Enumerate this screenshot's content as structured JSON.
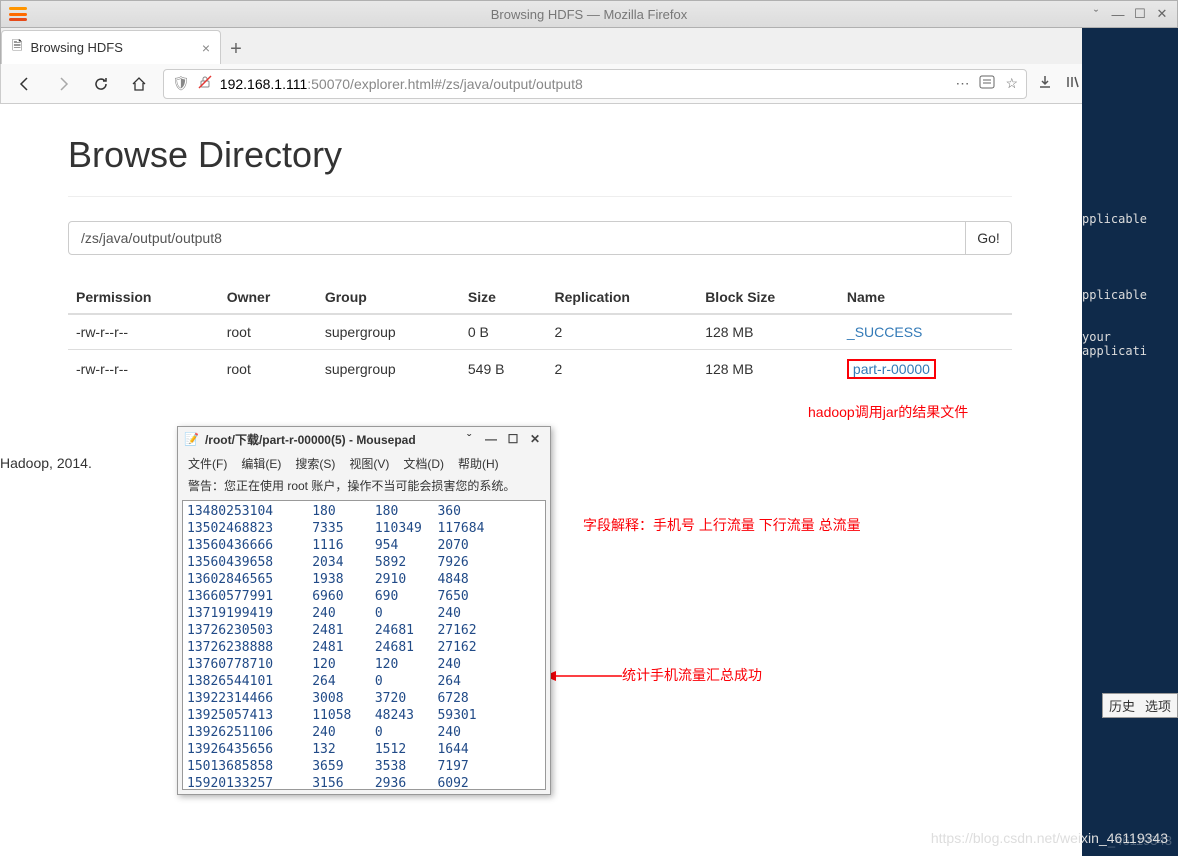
{
  "window": {
    "app_title": "Browsing HDFS — Mozilla Firefox",
    "tab_title": "Browsing HDFS"
  },
  "url": {
    "host": "192.168.1.111",
    "rest": ":50070/explorer.html#/zs/java/output/output8"
  },
  "page": {
    "heading": "Browse Directory",
    "path_value": "/zs/java/output/output8",
    "go_label": "Go!",
    "columns": [
      "Permission",
      "Owner",
      "Group",
      "Size",
      "Replication",
      "Block Size",
      "Name"
    ],
    "rows": [
      {
        "perm": "-rw-r--r--",
        "owner": "root",
        "group": "supergroup",
        "size": "0 B",
        "repl": "2",
        "bs": "128 MB",
        "name": "_SUCCESS"
      },
      {
        "perm": "-rw-r--r--",
        "owner": "root",
        "group": "supergroup",
        "size": "549 B",
        "repl": "2",
        "bs": "128 MB",
        "name": "part-r-00000"
      }
    ],
    "footer": "Hadoop, 2014."
  },
  "annotations": {
    "result_file": "hadoop调用jar的结果文件",
    "field_desc": "字段解释：手机号    上行流量    下行流量   总流量",
    "stat_ok": "统计手机流量汇总成功"
  },
  "mousepad": {
    "title": "/root/下载/part-r-00000(5) - Mousepad",
    "menus": [
      "文件(F)",
      "编辑(E)",
      "搜索(S)",
      "视图(V)",
      "文档(D)",
      "帮助(H)"
    ],
    "warning": "警告：您正在使用 root 账户，操作不当可能会损害您的系统。",
    "lines": [
      "13480253104     180     180     360",
      "13502468823     7335    110349  117684",
      "13560436666     1116    954     2070",
      "13560439658     2034    5892    7926",
      "13602846565     1938    2910    4848",
      "13660577991     6960    690     7650",
      "13719199419     240     0       240",
      "13726230503     2481    24681   27162",
      "13726238888     2481    24681   27162",
      "13760778710     120     120     240",
      "13826544101     264     0       264",
      "13922314466     3008    3720    6728",
      "13925057413     11058   48243   59301",
      "13926251106     240     0       240",
      "13926435656     132     1512    1644",
      "15013685858     3659    3538    7197",
      "15920133257     3156    2936    6092"
    ]
  },
  "darkpanel": {
    "t1": "pplicable",
    "t2": "pplicable",
    "t3": "your applicati",
    "tab1": "历史",
    "tab2": "选项",
    "wm": "_46119343"
  },
  "watermark": "https://blog.csdn.net/weixin_46119343"
}
